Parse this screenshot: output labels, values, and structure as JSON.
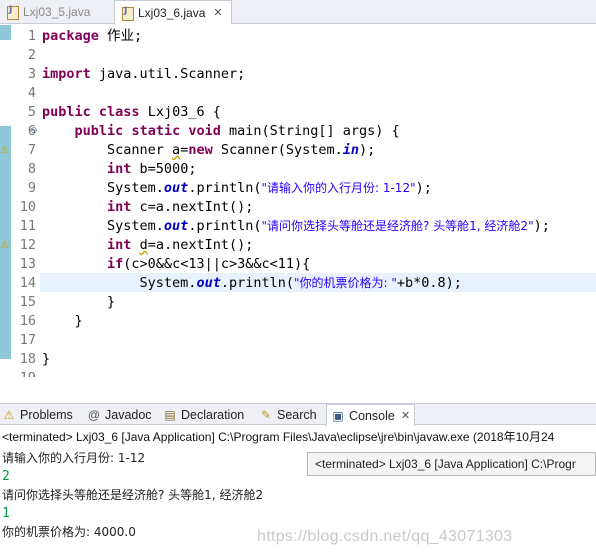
{
  "editor_tabs": [
    {
      "label": "Lxj03_5.java",
      "active": false
    },
    {
      "label": "Lxj03_6.java",
      "active": true,
      "close": "✕"
    }
  ],
  "code": {
    "line_numbers": [
      "1",
      "2",
      "3",
      "4",
      "5",
      "6",
      "7",
      "8",
      "9",
      "10",
      "11",
      "12",
      "13",
      "14",
      "15",
      "16",
      "17",
      "18",
      "19"
    ],
    "lines": [
      {
        "n": 1,
        "segments": [
          {
            "t": "package",
            "c": "kw"
          },
          {
            "t": " 作业;",
            "c": "var"
          }
        ]
      },
      {
        "n": 2,
        "segments": []
      },
      {
        "n": 3,
        "segments": [
          {
            "t": "import",
            "c": "kw"
          },
          {
            "t": " java.util.Scanner;",
            "c": "var"
          }
        ]
      },
      {
        "n": 4,
        "segments": []
      },
      {
        "n": 5,
        "segments": [
          {
            "t": "public",
            "c": "kw"
          },
          {
            "t": " ",
            "c": "var"
          },
          {
            "t": "class",
            "c": "kw"
          },
          {
            "t": " Lxj03_6 {",
            "c": "var"
          }
        ]
      },
      {
        "n": 6,
        "segments": [
          {
            "t": "    ",
            "c": "var"
          },
          {
            "t": "public",
            "c": "kw"
          },
          {
            "t": " ",
            "c": "var"
          },
          {
            "t": "static",
            "c": "kw"
          },
          {
            "t": " ",
            "c": "var"
          },
          {
            "t": "void",
            "c": "kw"
          },
          {
            "t": " main(String[] args) {",
            "c": "var"
          }
        ]
      },
      {
        "n": 7,
        "segments": [
          {
            "t": "        Scanner ",
            "c": "var"
          },
          {
            "t": "a",
            "c": "ul"
          },
          {
            "t": "=",
            "c": "var"
          },
          {
            "t": "new",
            "c": "kw"
          },
          {
            "t": " Scanner(System.",
            "c": "var"
          },
          {
            "t": "in",
            "c": "fld"
          },
          {
            "t": ");",
            "c": "var"
          }
        ]
      },
      {
        "n": 8,
        "segments": [
          {
            "t": "        ",
            "c": "var"
          },
          {
            "t": "int",
            "c": "kw"
          },
          {
            "t": " b=5000;",
            "c": "var"
          }
        ]
      },
      {
        "n": 9,
        "segments": [
          {
            "t": "        System.",
            "c": "var"
          },
          {
            "t": "out",
            "c": "fld"
          },
          {
            "t": ".println(",
            "c": "var"
          },
          {
            "t": "\"请输入你的入行月份: 1-12\"",
            "c": "str"
          },
          {
            "t": ");",
            "c": "var"
          }
        ]
      },
      {
        "n": 10,
        "segments": [
          {
            "t": "        ",
            "c": "var"
          },
          {
            "t": "int",
            "c": "kw"
          },
          {
            "t": " c=a.nextInt();",
            "c": "var"
          }
        ]
      },
      {
        "n": 11,
        "segments": [
          {
            "t": "        System.",
            "c": "var"
          },
          {
            "t": "out",
            "c": "fld"
          },
          {
            "t": ".println(",
            "c": "var"
          },
          {
            "t": "\"请问你选择头等舱还是经济舱? 头等舱1, 经济舱2\"",
            "c": "str"
          },
          {
            "t": ");",
            "c": "var"
          }
        ]
      },
      {
        "n": 12,
        "segments": [
          {
            "t": "        ",
            "c": "var"
          },
          {
            "t": "int",
            "c": "kw"
          },
          {
            "t": " ",
            "c": "var"
          },
          {
            "t": "d",
            "c": "ul"
          },
          {
            "t": "=a.nextInt();",
            "c": "var"
          }
        ]
      },
      {
        "n": 13,
        "segments": [
          {
            "t": "        ",
            "c": "var"
          },
          {
            "t": "if",
            "c": "kw"
          },
          {
            "t": "(c>0&&c<13||c>3&&c<11){",
            "c": "var"
          }
        ]
      },
      {
        "n": 14,
        "segments": [
          {
            "t": "            System.",
            "c": "var"
          },
          {
            "t": "out",
            "c": "fld"
          },
          {
            "t": ".println(",
            "c": "var"
          },
          {
            "t": "\"你的机票价格为: \"",
            "c": "str"
          },
          {
            "t": "+b*0.8);",
            "c": "var"
          }
        ]
      },
      {
        "n": 15,
        "segments": [
          {
            "t": "        }",
            "c": "var"
          }
        ]
      },
      {
        "n": 16,
        "segments": [
          {
            "t": "    }",
            "c": "var"
          }
        ]
      },
      {
        "n": 17,
        "segments": []
      },
      {
        "n": 18,
        "segments": [
          {
            "t": "}",
            "c": "var"
          }
        ]
      },
      {
        "n": 19,
        "segments": []
      }
    ]
  },
  "view_tabs": [
    {
      "label": "Problems",
      "icon": "problems-icon",
      "glyph": "⚠"
    },
    {
      "label": "Javadoc",
      "icon": "javadoc-icon",
      "glyph": "@"
    },
    {
      "label": "Declaration",
      "icon": "declaration-icon",
      "glyph": "▤"
    },
    {
      "label": "Search",
      "icon": "search-icon",
      "glyph": "🔦"
    },
    {
      "label": "Console",
      "icon": "console-icon",
      "glyph": "▣",
      "active": true,
      "close": "✕"
    }
  ],
  "console": {
    "status": "<terminated> Lxj03_6 [Java Application] C:\\Program Files\\Java\\eclipse\\jre\\bin\\javaw.exe (2018年10月24",
    "tooltip": "<terminated> Lxj03_6 [Java Application] C:\\Progr",
    "output": [
      {
        "text": "请输入你的入行月份: 1-12",
        "kind": "cn"
      },
      {
        "text": "2",
        "kind": "in"
      },
      {
        "text": "请问你选择头等舱还是经济舱? 头等舱1, 经济舱2",
        "kind": "cn"
      },
      {
        "text": "1",
        "kind": "in"
      },
      {
        "text": "你的机票价格为: 4000.0",
        "kind": "cn"
      }
    ]
  },
  "watermark": "https://blog.csdn.net/qq_43071303",
  "colors": {
    "keyword": "#7f0055",
    "string": "#2a00ff",
    "field": "#0000c0",
    "input": "#00a040",
    "line_highlight": "#e8f2fe",
    "ruler": "#8fc7d8"
  }
}
